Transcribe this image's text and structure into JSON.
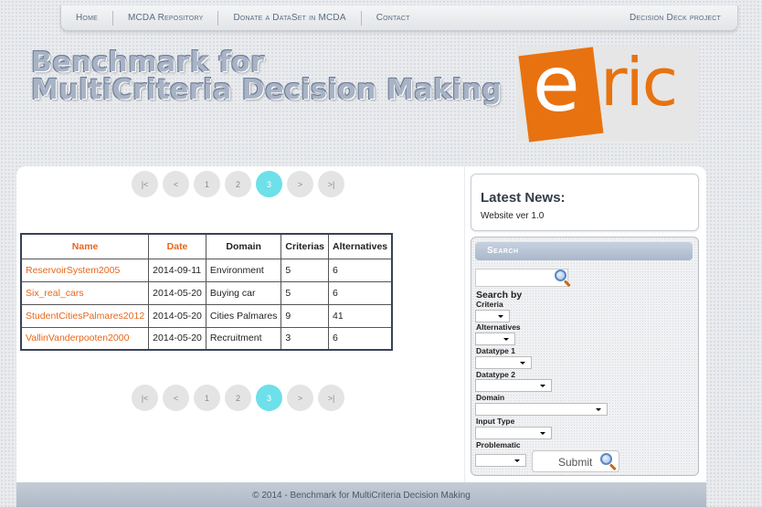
{
  "nav": {
    "items": [
      "Home",
      "MCDA Repository",
      "Donate a DataSet in MCDA",
      "Contact"
    ],
    "right": "Decision Deck project"
  },
  "header": {
    "title_line1": "Benchmark for",
    "title_line2": "MultiCriteria Decision Making",
    "logo_letter": "e",
    "logo_rest": "ric"
  },
  "pager": {
    "buttons": [
      "|<",
      "<",
      "1",
      "2",
      "3",
      ">",
      ">|"
    ],
    "active": "3"
  },
  "table": {
    "columns": [
      "Name",
      "Date",
      "Domain",
      "Criterias",
      "Alternatives"
    ],
    "rows": [
      [
        "ReservoirSystem2005",
        "2014-09-11",
        "Environment",
        "5",
        "6"
      ],
      [
        "Six_real_cars",
        "2014-05-20",
        "Buying car",
        "5",
        "6"
      ],
      [
        "StudentCitiesPalmares2012",
        "2014-05-20",
        "Cities Palmares",
        "9",
        "41"
      ],
      [
        "VallinVanderpooten2000",
        "2014-05-20",
        "Recruitment",
        "3",
        "6"
      ]
    ]
  },
  "news": {
    "heading": "Latest News:",
    "item": "Website ver 1.0"
  },
  "search": {
    "header": "Search",
    "search_by": "Search by",
    "labels": {
      "criteria": "Criteria",
      "alternatives": "Alternatives",
      "datatype1": "Datatype 1",
      "datatype2": "Datatype 2",
      "domain": "Domain",
      "input_type": "Input Type",
      "problematic": "Problematic"
    },
    "submit_label": "Submit"
  },
  "footer": {
    "text": "© 2014 - Benchmark for MultiCriteria Decision Making"
  },
  "colors": {
    "accent_orange": "#e8661a",
    "active_page": "#6de0ea",
    "logo_orange": "#e8720f"
  }
}
